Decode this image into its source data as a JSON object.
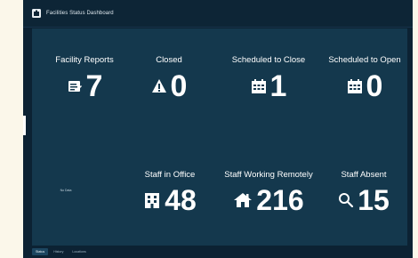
{
  "header": {
    "title": "Facilities Status Dashboard",
    "logo": "app-logo-icon"
  },
  "cards": {
    "facility_reports": {
      "label": "Facility Reports",
      "value": "7",
      "icon": "report-icon"
    },
    "closed": {
      "label": "Closed",
      "value": "0",
      "icon": "warning-icon"
    },
    "scheduled_close": {
      "label": "Scheduled to Close",
      "value": "1",
      "icon": "calendar-icon"
    },
    "scheduled_open": {
      "label": "Scheduled to Open",
      "value": "0",
      "icon": "calendar-icon"
    },
    "staff_office": {
      "label": "Staff in Office",
      "value": "48",
      "icon": "building-icon"
    },
    "staff_remote": {
      "label": "Staff Working Remotely",
      "value": "216",
      "icon": "home-icon"
    },
    "staff_absent": {
      "label": "Staff Absent",
      "value": "15",
      "icon": "search-icon"
    }
  },
  "empty_panel": {
    "text": "No Data"
  },
  "tabs": [
    {
      "label": "Status"
    },
    {
      "label": "History"
    },
    {
      "label": "Locations"
    }
  ],
  "colors": {
    "page_bg": "#fbf7ea",
    "frame_bg": "#0c2233",
    "panel_bg": "#14384d",
    "text": "#ffffff"
  }
}
